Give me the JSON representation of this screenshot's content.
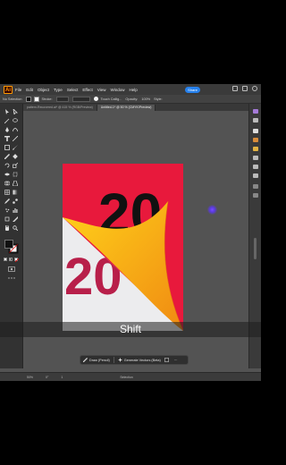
{
  "app": {
    "logo": "Ai"
  },
  "menubar": {
    "items": [
      "File",
      "Edit",
      "Object",
      "Type",
      "Select",
      "Effect",
      "View",
      "Window",
      "Help"
    ],
    "share_label": "Share"
  },
  "controlbar": {
    "selection_label": "No Selection",
    "stroke_label": "Stroke:",
    "style_label": "Touch Callig...",
    "opacity_label": "Opacity:",
    "opacity_value": "100%",
    "style2_label": "Style:"
  },
  "tabs": [
    {
      "label": "pattern-Recovered.ai* @ 415 % (RGB/Preview)",
      "active": false
    },
    {
      "label": "Untitled-1* @ 50 % (CMYK/Preview)",
      "active": true
    }
  ],
  "artwork": {
    "top_number": "20",
    "bottom_number": "20",
    "colors": {
      "red": "#e8193c",
      "paper": "#ececee",
      "ink": "#111111",
      "crimson": "#b81f4a",
      "fold_light": "#ffd21a",
      "fold_dark": "#f08a12"
    }
  },
  "overlay": {
    "key_label": "Shift"
  },
  "taskbar": {
    "draw_label": "Draw (Pencil)",
    "generate_label": "Generate Vectors (Beta)",
    "more_label": "···"
  },
  "statusbar": {
    "zoom_value": "50%",
    "angle_value": "0°",
    "artboard_value": "1",
    "mode_label": "Selection"
  },
  "icons": [
    "ai-logo-icon",
    "selection-tool-icon",
    "direct-selection-tool-icon",
    "pen-tool-icon",
    "type-tool-icon",
    "shape-tool-icon",
    "brush-tool-icon",
    "pencil-tool-icon",
    "eraser-tool-icon",
    "rotate-tool-icon",
    "scale-tool-icon",
    "hand-tool-icon",
    "zoom-tool-icon",
    "fill-stroke-icon",
    "pencil-icon",
    "generate-vectors-icon"
  ]
}
